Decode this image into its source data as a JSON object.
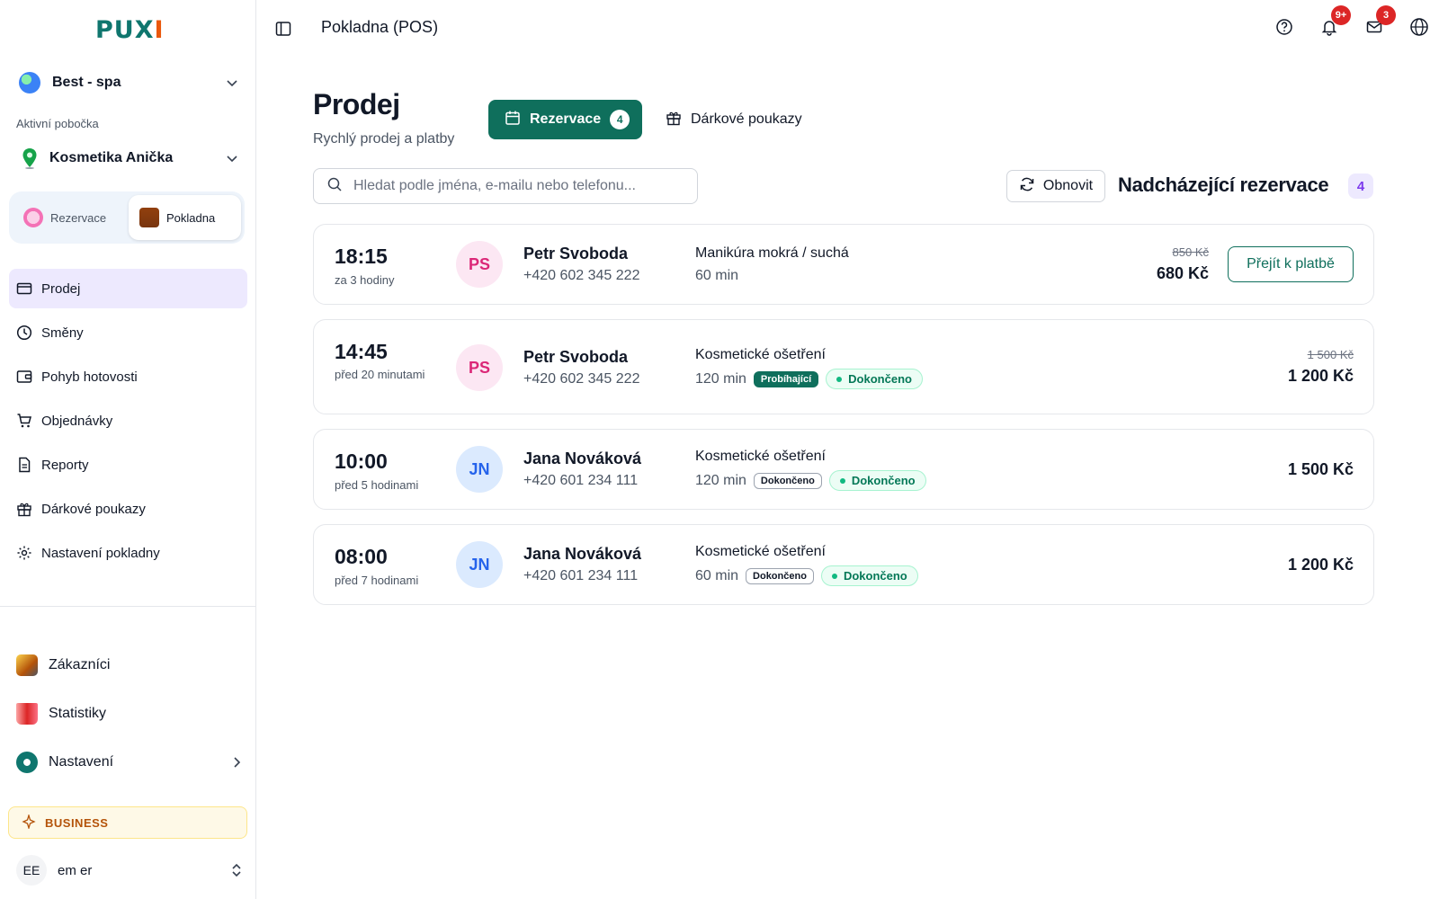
{
  "sidebar": {
    "logo": {
      "main": "PUX",
      "accent": "I"
    },
    "org": {
      "name": "Best - spa"
    },
    "branch_label": "Aktivní pobočka",
    "branch": {
      "name": "Kosmetika Anička"
    },
    "modes": [
      {
        "label": "Rezervace",
        "active": false
      },
      {
        "label": "Pokladna",
        "active": true
      }
    ],
    "nav": [
      {
        "label": "Prodej",
        "icon": "credit-card-icon",
        "active": true
      },
      {
        "label": "Směny",
        "icon": "clock-icon",
        "active": false
      },
      {
        "label": "Pohyb hotovosti",
        "icon": "wallet-icon",
        "active": false
      },
      {
        "label": "Objednávky",
        "icon": "cart-icon",
        "active": false
      },
      {
        "label": "Reporty",
        "icon": "document-icon",
        "active": false
      },
      {
        "label": "Dárkové poukazy",
        "icon": "gift-icon",
        "active": false
      },
      {
        "label": "Nastavení pokladny",
        "icon": "gear-icon",
        "active": false
      }
    ],
    "secondary_nav": [
      {
        "label": "Zákazníci",
        "icon": "customers-icon"
      },
      {
        "label": "Statistiky",
        "icon": "stats-icon"
      },
      {
        "label": "Nastavení",
        "icon": "settings-icon"
      }
    ],
    "plan_badge": "BUSINESS",
    "user": {
      "initials": "EE",
      "name": "em er"
    }
  },
  "topbar": {
    "title": "Pokladna (POS)",
    "notifications_count": "9+",
    "mail_count": "3"
  },
  "main": {
    "title": "Prodej",
    "subtitle": "Rychlý prodej a platby",
    "tabs": {
      "reservations": {
        "label": "Rezervace",
        "count": "4"
      },
      "gift": {
        "label": "Dárkové poukazy"
      }
    },
    "search": {
      "placeholder": "Hledat podle jména, e-mailu nebo telefonu..."
    },
    "refresh_label": "Obnovit",
    "upcoming_title": "Nadcházející rezervace",
    "upcoming_count": "4",
    "reservations": [
      {
        "time": "18:15",
        "relative": "za 3 hodiny",
        "initials": "PS",
        "avatar_color": "pink",
        "name": "Petr Svoboda",
        "phone": "+420 602 345 222",
        "service": "Manikúra mokrá / suchá",
        "duration": "60 min",
        "status_pill": "",
        "status_style": "",
        "state": "",
        "price_old": "850 Kč",
        "price": "680 Kč",
        "action": "Přejít k platbě"
      },
      {
        "time": "14:45",
        "relative": "před 20 minutami",
        "initials": "PS",
        "avatar_color": "pink",
        "name": "Petr Svoboda",
        "phone": "+420 602 345 222",
        "service": "Kosmetické ošetření",
        "duration": "120 min",
        "status_pill": "Probíhající",
        "status_style": "dark",
        "state": "Dokončeno",
        "price_old": "1 500 Kč",
        "price": "1 200 Kč",
        "action": ""
      },
      {
        "time": "10:00",
        "relative": "před 5 hodinami",
        "initials": "JN",
        "avatar_color": "blue",
        "name": "Jana Nováková",
        "phone": "+420 601 234 111",
        "service": "Kosmetické ošetření",
        "duration": "120 min",
        "status_pill": "Dokončeno",
        "status_style": "outline",
        "state": "Dokončeno",
        "price_old": "",
        "price": "1 500 Kč",
        "action": ""
      },
      {
        "time": "08:00",
        "relative": "před 7 hodinami",
        "initials": "JN",
        "avatar_color": "blue",
        "name": "Jana Nováková",
        "phone": "+420 601 234 111",
        "service": "Kosmetické ošetření",
        "duration": "60 min",
        "status_pill": "Dokončeno",
        "status_style": "outline",
        "state": "Dokončeno",
        "price_old": "",
        "price": "1 200 Kč",
        "action": ""
      }
    ]
  },
  "colors": {
    "primary": "#0f6f5c",
    "active_nav": "#ede9fe",
    "badge": "#dc2626"
  }
}
